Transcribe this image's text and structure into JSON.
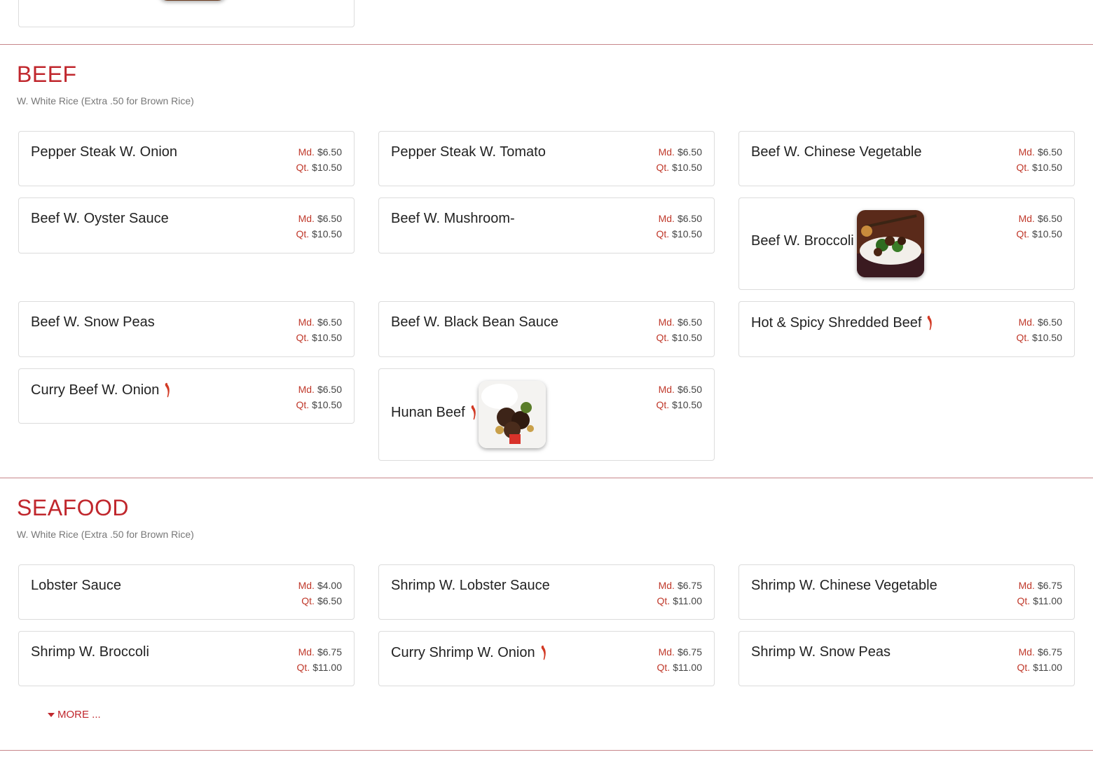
{
  "sections": {
    "beef": {
      "title": "BEEF",
      "note": "W. White Rice (Extra .50 for Brown Rice)",
      "items": [
        {
          "name": "Pepper Steak W. Onion",
          "md_label": "Md.",
          "md": "$6.50",
          "qt_label": "Qt.",
          "qt": "$10.50"
        },
        {
          "name": "Pepper Steak W. Tomato",
          "md_label": "Md.",
          "md": "$6.50",
          "qt_label": "Qt.",
          "qt": "$10.50"
        },
        {
          "name": "Beef W. Chinese Vegetable",
          "md_label": "Md.",
          "md": "$6.50",
          "qt_label": "Qt.",
          "qt": "$10.50"
        },
        {
          "name": "Beef W. Oyster Sauce",
          "md_label": "Md.",
          "md": "$6.50",
          "qt_label": "Qt.",
          "qt": "$10.50"
        },
        {
          "name": "Beef W. Mushroom-",
          "md_label": "Md.",
          "md": "$6.50",
          "qt_label": "Qt.",
          "qt": "$10.50"
        },
        {
          "name": "Beef W. Broccoli",
          "md_label": "Md.",
          "md": "$6.50",
          "qt_label": "Qt.",
          "qt": "$10.50"
        },
        {
          "name": "Beef W. Snow Peas",
          "md_label": "Md.",
          "md": "$6.50",
          "qt_label": "Qt.",
          "qt": "$10.50"
        },
        {
          "name": "Beef W. Black Bean Sauce",
          "md_label": "Md.",
          "md": "$6.50",
          "qt_label": "Qt.",
          "qt": "$10.50"
        },
        {
          "name": "Hot & Spicy Shredded Beef",
          "md_label": "Md.",
          "md": "$6.50",
          "qt_label": "Qt.",
          "qt": "$10.50"
        },
        {
          "name": "Curry Beef W. Onion",
          "md_label": "Md.",
          "md": "$6.50",
          "qt_label": "Qt.",
          "qt": "$10.50"
        },
        {
          "name": "Hunan Beef",
          "md_label": "Md.",
          "md": "$6.50",
          "qt_label": "Qt.",
          "qt": "$10.50"
        }
      ]
    },
    "seafood": {
      "title": "SEAFOOD",
      "note": "W. White Rice (Extra .50 for Brown Rice)",
      "items": [
        {
          "name": "Lobster Sauce",
          "md_label": "Md.",
          "md": "$4.00",
          "qt_label": "Qt.",
          "qt": "$6.50"
        },
        {
          "name": "Shrimp W. Lobster Sauce",
          "md_label": "Md.",
          "md": "$6.75",
          "qt_label": "Qt.",
          "qt": "$11.00"
        },
        {
          "name": "Shrimp W. Chinese Vegetable",
          "md_label": "Md.",
          "md": "$6.75",
          "qt_label": "Qt.",
          "qt": "$11.00"
        },
        {
          "name": "Shrimp W. Broccoli",
          "md_label": "Md.",
          "md": "$6.75",
          "qt_label": "Qt.",
          "qt": "$11.00"
        },
        {
          "name": "Curry Shrimp W. Onion",
          "md_label": "Md.",
          "md": "$6.75",
          "qt_label": "Qt.",
          "qt": "$11.00"
        },
        {
          "name": "Shrimp W. Snow Peas",
          "md_label": "Md.",
          "md": "$6.75",
          "qt_label": "Qt.",
          "qt": "$11.00"
        }
      ],
      "more_label": "MORE ..."
    }
  },
  "icons": {
    "spicy": "chili-pepper-icon",
    "more": "caret-down-icon"
  },
  "colors": {
    "accent": "#c0272d",
    "divider": "#c7868a",
    "price_label": "#c0392b"
  }
}
